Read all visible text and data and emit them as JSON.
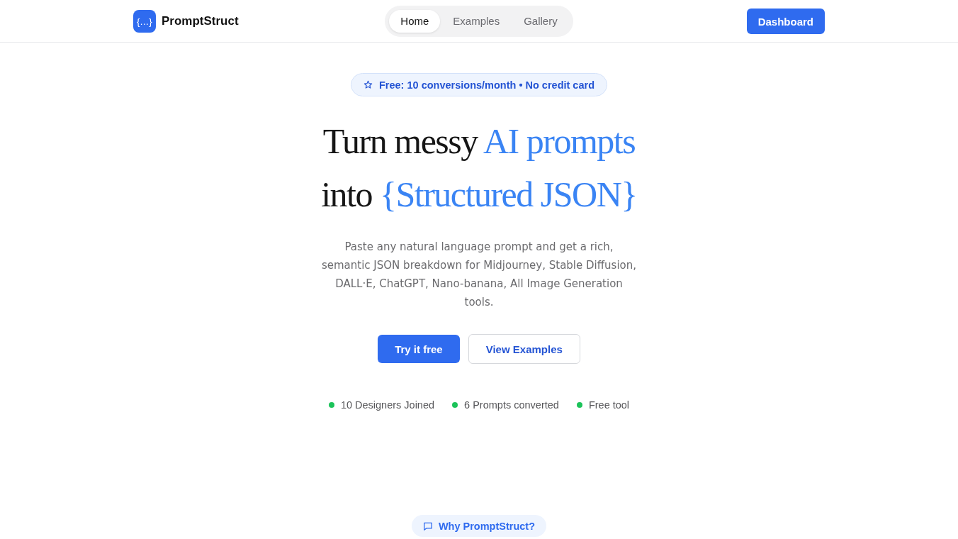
{
  "header": {
    "logo": {
      "glyph": "{...}",
      "name": "PromptStruct"
    },
    "nav": [
      {
        "label": "Home",
        "selected": true
      },
      {
        "label": "Examples",
        "selected": false
      },
      {
        "label": "Gallery",
        "selected": false
      }
    ],
    "cta": "Dashboard"
  },
  "hero": {
    "badge": "Free: 10 conversions/month • No credit card",
    "headline": [
      [
        {
          "text": "Turn messy ",
          "accent": false
        },
        {
          "text": "AI prompts",
          "accent": true
        }
      ],
      [
        {
          "text": "into ",
          "accent": false
        },
        {
          "text": "{Structured JSON}",
          "accent": true
        }
      ]
    ],
    "description": "Paste any natural language prompt and get a rich, semantic JSON breakdown for Midjourney, Stable Diffusion, DALL·E, ChatGPT, Nano-banana, All Image Generation tools.",
    "buttons": [
      {
        "label": "Try it free",
        "kind": "primary"
      },
      {
        "label": "View Examples",
        "kind": "outline"
      }
    ],
    "stats": [
      "10 Designers Joined",
      "6 Prompts converted",
      "Free tool"
    ]
  },
  "section_tag": "Why PromptStruct?"
}
